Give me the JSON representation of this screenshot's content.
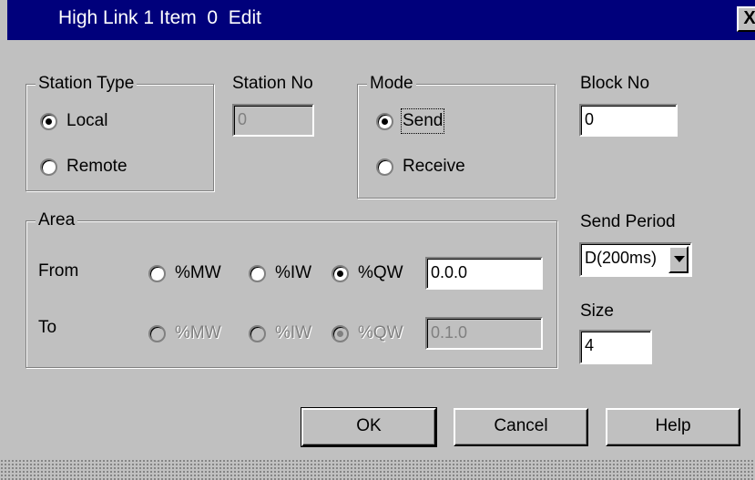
{
  "window": {
    "title": "High Link 1 Item  0  Edit",
    "close_glyph": "X"
  },
  "station_type": {
    "legend": "Station Type",
    "options": [
      {
        "label": "Local",
        "checked": true
      },
      {
        "label": "Remote",
        "checked": false
      }
    ]
  },
  "station_no": {
    "label": "Station No",
    "value": "0",
    "enabled": false
  },
  "mode": {
    "legend": "Mode",
    "options": [
      {
        "label": "Send",
        "checked": true
      },
      {
        "label": "Receive",
        "checked": false
      }
    ]
  },
  "block_no": {
    "label": "Block No",
    "value": "0"
  },
  "area": {
    "legend": "Area",
    "from": {
      "label": "From",
      "options": [
        {
          "label": "%MW",
          "checked": false
        },
        {
          "label": "%IW",
          "checked": false
        },
        {
          "label": "%QW",
          "checked": true
        }
      ],
      "value": "0.0.0"
    },
    "to": {
      "label": "To",
      "enabled": false,
      "options": [
        {
          "label": "%MW",
          "checked": false
        },
        {
          "label": "%IW",
          "checked": false
        },
        {
          "label": "%QW",
          "checked": true
        }
      ],
      "value": "0.1.0"
    }
  },
  "send_period": {
    "label": "Send Period",
    "selected": "D(200ms)"
  },
  "size": {
    "label": "Size",
    "value": "4"
  },
  "buttons": {
    "ok": "OK",
    "cancel": "Cancel",
    "help": "Help"
  },
  "colors": {
    "title_bar": "#00007b",
    "dialog_face": "#c0c0c0",
    "disabled_text": "#808080"
  }
}
